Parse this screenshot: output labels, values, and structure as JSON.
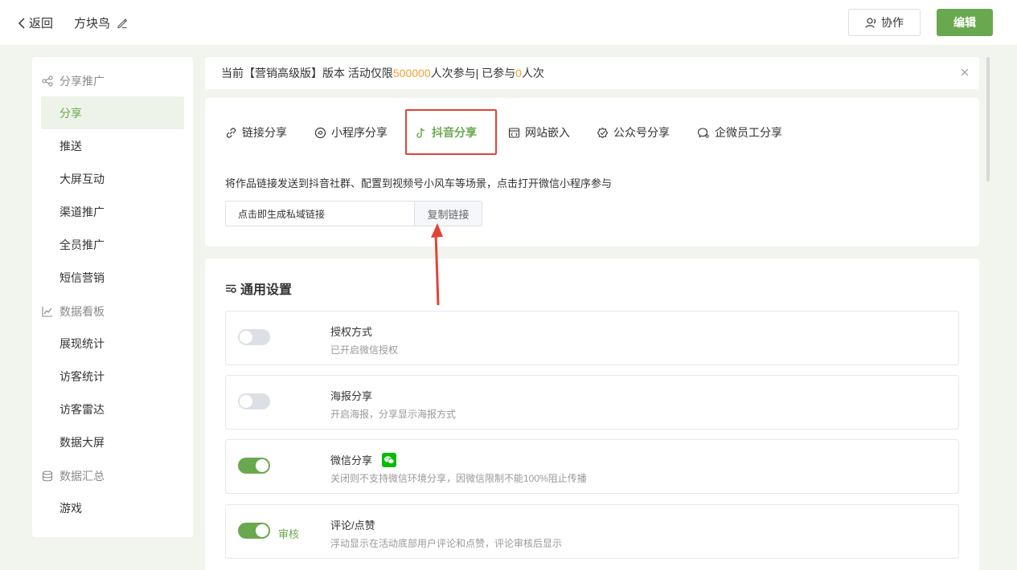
{
  "header": {
    "back_label": "返回",
    "doc_title": "方块鸟",
    "collab_label": "协作",
    "edit_label": "编辑"
  },
  "sidebar": {
    "groups": [
      {
        "label": "分享推广",
        "icon": "share-icon"
      },
      {
        "label": "数据看板",
        "icon": "chart-line-icon"
      },
      {
        "label": "数据汇总",
        "icon": "database-icon"
      }
    ],
    "items": [
      {
        "label": "分享",
        "active": true
      },
      {
        "label": "推送"
      },
      {
        "label": "大屏互动"
      },
      {
        "label": "渠道推广"
      },
      {
        "label": "全员推广"
      },
      {
        "label": "短信营销"
      },
      {
        "label": "展现统计"
      },
      {
        "label": "访客统计"
      },
      {
        "label": "访客雷达"
      },
      {
        "label": "数据大屏"
      },
      {
        "label": "游戏"
      }
    ]
  },
  "notice": {
    "prefix": "当前【营销高级版】版本 活动仅限 ",
    "limit": "500000",
    "middle": " 人次参与| 已参与 ",
    "joined": "0",
    "suffix": " 人次"
  },
  "share": {
    "tabs": [
      {
        "label": "链接分享",
        "icon": "link-icon"
      },
      {
        "label": "小程序分享",
        "icon": "miniprogram-icon"
      },
      {
        "label": "抖音分享",
        "icon": "douyin-icon",
        "active": true
      },
      {
        "label": "网站嵌入",
        "icon": "embed-icon"
      },
      {
        "label": "公众号分享",
        "icon": "official-account-icon"
      },
      {
        "label": "企微员工分享",
        "icon": "wecom-icon"
      }
    ],
    "description": "将作品链接发送到抖音社群、配置到视频号小风车等场景，点击打开微信小程序参与",
    "link_value": "点击即生成私域链接",
    "copy_label": "复制链接"
  },
  "settings": {
    "title": "通用设置",
    "rows": [
      {
        "title": "授权方式",
        "sub": "已开启微信授权",
        "on": false,
        "extra": ""
      },
      {
        "title": "海报分享",
        "sub": "开启海报，分享显示海报方式",
        "on": false,
        "extra": ""
      },
      {
        "title": "微信分享",
        "sub": "关闭则不支持微信环境分享，因微信限制不能100%阻止传播",
        "on": true,
        "extra": "",
        "badge": "wechat-icon"
      },
      {
        "title": "评论/点赞",
        "sub": "浮动显示在活动底部用户评论和点赞，评论审核后显示",
        "on": true,
        "extra": "审核"
      }
    ]
  },
  "colors": {
    "brand": "#6aa84f",
    "highlight_number": "#f0a030",
    "annotation": "#e04438",
    "wechat": "#09bb07"
  }
}
